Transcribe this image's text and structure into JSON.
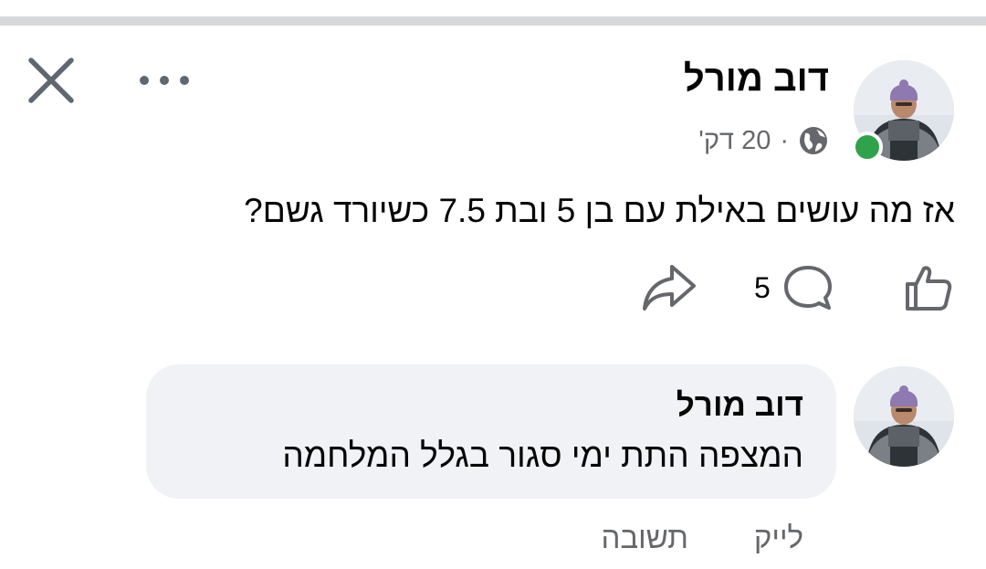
{
  "post": {
    "author": "דוב מורל",
    "time": "20 דק'",
    "separator": "·",
    "privacy_icon": "globe-icon",
    "text": "אז מה עושים באילת עם בן 5 ובת 7.5 כשיורד גשם?",
    "comment_count": "5",
    "online": true
  },
  "header": {
    "close_icon": "close-icon",
    "more_icon": "more-icon"
  },
  "actions": {
    "like_icon": "like-icon",
    "comment_icon": "comment-icon",
    "share_icon": "share-icon"
  },
  "comment": {
    "author": "דוב מורל",
    "text": "המצפה התת ימי סגור בגלל המלחמה",
    "like_label": "לייק",
    "reply_label": "תשובה"
  },
  "colors": {
    "online": "#31a24c",
    "bubble": "#f0f2f5",
    "secondary_text": "#65676b"
  }
}
